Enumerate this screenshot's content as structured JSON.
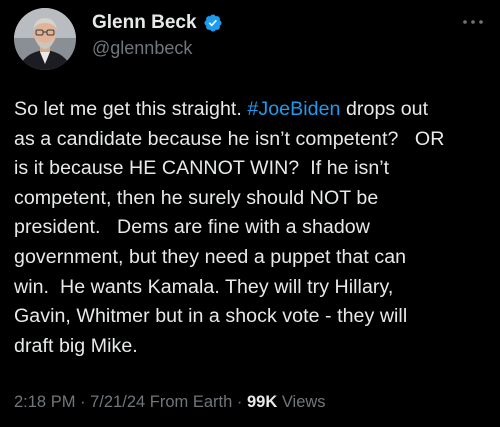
{
  "author": {
    "display_name": "Glenn Beck",
    "handle": "@glennbeck",
    "verified": true
  },
  "icons": {
    "verified": "verified-badge-icon",
    "more": "more-horizontal-icon"
  },
  "colors": {
    "background": "#000000",
    "text": "#e7e9ea",
    "secondary": "#71767b",
    "accent": "#1d9bf0"
  },
  "tweet": {
    "text_before_hashtag": "So let me get this straight. ",
    "hashtag": "#JoeBiden",
    "text_after_hashtag": " drops out\nas a candidate because he isn’t competent?   OR\nis it because HE CANNOT WIN?  If he isn’t\ncompetent, then he surely should NOT be\npresident.   Dems are fine with a shadow\ngovernment, but they need a puppet that can\nwin.  He wants Kamala. They will try Hillary,\nGavin, Whitmer but in a shock vote - they will\ndraft big Mike."
  },
  "meta": {
    "time": "2:18 PM",
    "separator1": " · ",
    "date": "7/21/24",
    "source": " From Earth",
    "separator2": " · ",
    "views_count": "99K",
    "views_label": " Views"
  }
}
